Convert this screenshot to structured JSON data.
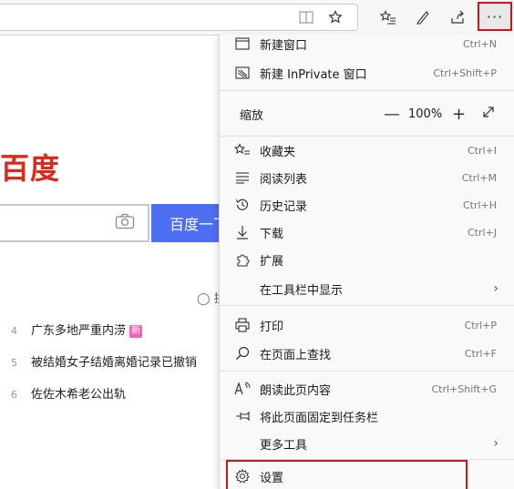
{
  "toolbar": {
    "more_label": "···",
    "icons": [
      "reading-view-icon",
      "favorite-star-icon",
      "favorites-list-icon",
      "pen-icon",
      "share-icon"
    ]
  },
  "page": {
    "logo": "百度",
    "search_button": "百度一下",
    "refresh_label": "换",
    "hot_list": [
      {
        "num": "4",
        "text": "广东多地严重内涝",
        "badge": "新"
      },
      {
        "num": "5",
        "text": "被结婚女子结婚离婚记录已撤销",
        "badge": ""
      },
      {
        "num": "6",
        "text": "佐佐木希老公出轨",
        "badge": ""
      }
    ]
  },
  "menu": {
    "new_window": {
      "label": "新建窗口",
      "shortcut": "Ctrl+N"
    },
    "new_inprivate": {
      "label": "新建 InPrivate 窗口",
      "shortcut": "Ctrl+Shift+P"
    },
    "zoom": {
      "label": "缩放",
      "minus": "—",
      "value": "100%",
      "plus": "+"
    },
    "favorites": {
      "label": "收藏夹",
      "shortcut": "Ctrl+I"
    },
    "reading_list": {
      "label": "阅读列表",
      "shortcut": "Ctrl+M"
    },
    "history": {
      "label": "历史记录",
      "shortcut": "Ctrl+H"
    },
    "downloads": {
      "label": "下载",
      "shortcut": "Ctrl+J"
    },
    "extensions": {
      "label": "扩展"
    },
    "show_in_toolbar": {
      "label": "在工具栏中显示",
      "chevron": "›"
    },
    "print": {
      "label": "打印",
      "shortcut": "Ctrl+P"
    },
    "find": {
      "label": "在页面上查找",
      "shortcut": "Ctrl+F"
    },
    "read_aloud": {
      "label": "朗读此页内容",
      "shortcut": "Ctrl+Shift+G"
    },
    "pin_taskbar": {
      "label": "将此页面固定到任务栏"
    },
    "more_tools": {
      "label": "更多工具",
      "chevron": "›"
    },
    "settings": {
      "label": "设置"
    }
  },
  "colors": {
    "highlight_border": "#d0121b",
    "baidu_red": "#e1261c",
    "baidu_blue": "#4e6ef2"
  }
}
